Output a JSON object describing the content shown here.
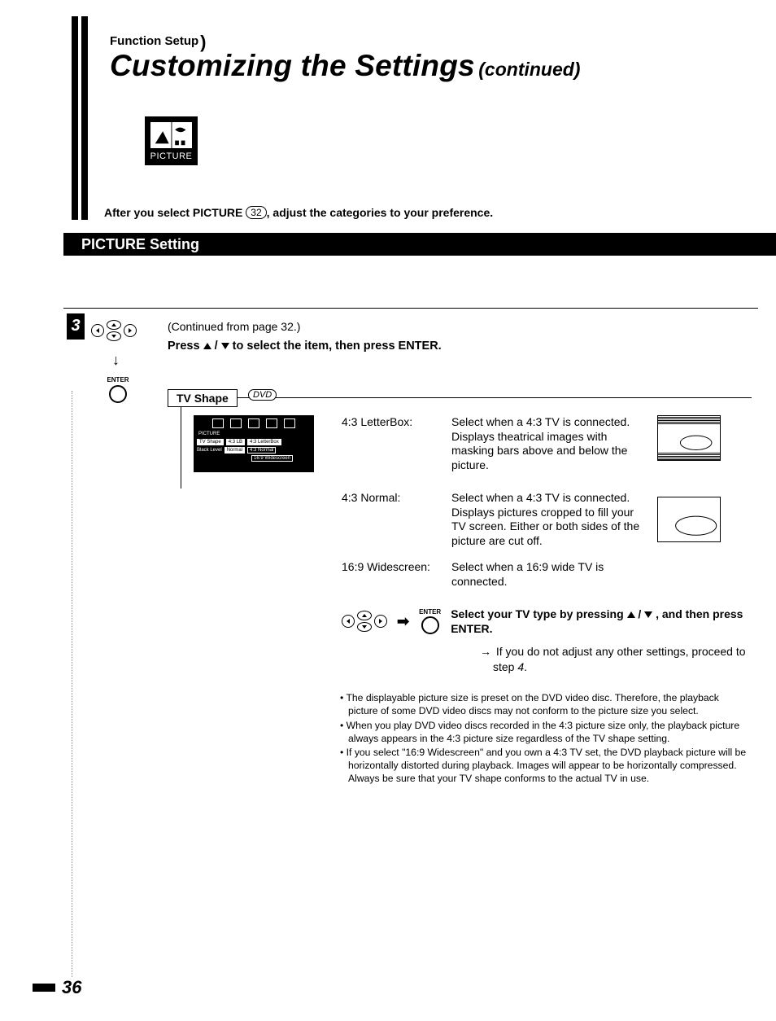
{
  "header": {
    "section_tag": "Function Setup",
    "title_main": "Customizing the Settings",
    "title_suffix": "(continued)"
  },
  "picture_badge": "PICTURE",
  "intro": {
    "prefix": "After you select PICTURE ",
    "pageref": "32",
    "suffix": ", adjust the categories to your preference."
  },
  "section_heading": "PICTURE Setting",
  "step": {
    "number": "3",
    "enter_label": "ENTER",
    "continued": "(Continued from page 32.)",
    "press_a": "Press ",
    "press_b": " to select the item, then press ENTER."
  },
  "tvshape": {
    "label": "TV Shape",
    "disc_tag": "DVD",
    "osd": {
      "heading": "PICTURE",
      "row1": [
        "TV Shape",
        "4:3 LB",
        "4:3 LetterBox"
      ],
      "row2": [
        "Black Level",
        "Normal",
        "4:3 Normal"
      ],
      "row3": "16:9 Widescreen"
    }
  },
  "options": [
    {
      "label": "4:3 LetterBox:",
      "desc": "Select when a 4:3 TV is connected. Displays theatrical images with masking bars above and below the picture."
    },
    {
      "label": "4:3 Normal:",
      "desc": "Select when a 4:3 TV is connected. Displays pictures cropped to fill your TV screen.  Either or both sides of the picture are cut off."
    },
    {
      "label": "16:9 Widescreen:",
      "desc": "Select when a 16:9 wide TV is connected."
    }
  ],
  "select_block": {
    "enter": "ENTER",
    "text_a": "Select your TV type by pressing ",
    "text_b": " , and then press ENTER.",
    "note_prefix": "→ ",
    "note": "If you do not adjust any other settings, proceed to step ",
    "note_step": "4",
    "note_suffix": "."
  },
  "bullets": [
    "The displayable picture size is preset on the DVD video disc. Therefore, the playback picture of some DVD video discs may not conform to the picture size you select.",
    "When you play DVD video discs recorded in the 4:3 picture size only, the playback picture always appears in the 4:3 picture size regardless of the TV shape setting.",
    "If you select \"16:9 Widescreen\" and you own a 4:3 TV set, the DVD playback picture will be horizontally distorted during playback. Images will appear to be horizontally compressed.  Always be sure that your TV shape conforms to the actual TV in use."
  ],
  "page_number": "36"
}
